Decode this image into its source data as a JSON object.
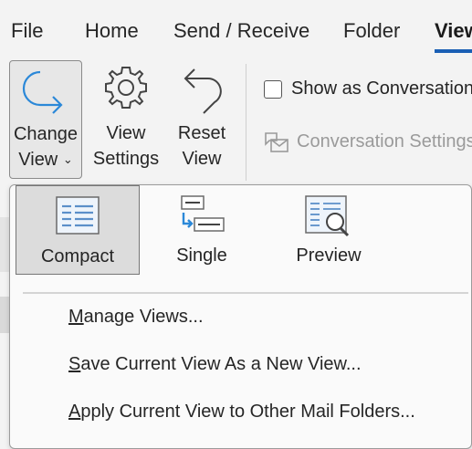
{
  "tabs": [
    {
      "label": "File"
    },
    {
      "label": "Home"
    },
    {
      "label": "Send / Receive"
    },
    {
      "label": "Folder"
    },
    {
      "label": "View",
      "active": true
    }
  ],
  "ribbon": {
    "change_view": {
      "line1": "Change",
      "line2": "View",
      "icon": "change-view-arrow-icon"
    },
    "view_settings": {
      "line1": "View",
      "line2": "Settings",
      "icon": "gear-icon"
    },
    "reset_view": {
      "line1": "Reset",
      "line2": "View",
      "icon": "reset-arrow-icon"
    },
    "show_as_conversations": {
      "label": "Show as Conversations",
      "checked": false
    },
    "conversation_settings": {
      "label": "Conversation Settings",
      "enabled": false
    }
  },
  "dropdown": {
    "views": [
      {
        "label": "Compact",
        "selected": true,
        "icon": "compact-view-icon"
      },
      {
        "label": "Single",
        "selected": false,
        "icon": "single-view-icon"
      },
      {
        "label": "Preview",
        "selected": false,
        "icon": "preview-view-icon"
      }
    ],
    "menu": [
      {
        "accel": "M",
        "rest": "anage Views..."
      },
      {
        "accel": "S",
        "rest": "ave Current View As a New View..."
      },
      {
        "accel": "A",
        "rest": "pply Current View to Other Mail Folders..."
      }
    ]
  },
  "colors": {
    "accent": "#1a5fb4",
    "icon_blue": "#2b88d8",
    "disabled_text": "#9a9a9a"
  }
}
